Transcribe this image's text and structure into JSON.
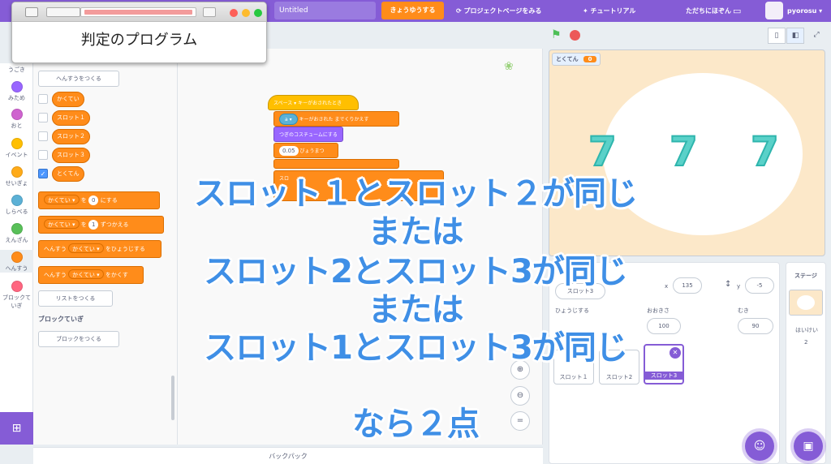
{
  "menubar": {
    "title_value": "Untitled",
    "share_label": "きょうゆうする",
    "project_page_label": "プロジェクトページをみる",
    "tutorial_label": "チュートリアル",
    "save_now_label": "ただちにほぞん",
    "username": "pyorosu",
    "accent_color": "#855cd6"
  },
  "overlay_window": {
    "title": "判定のプログラム"
  },
  "categories": [
    {
      "label": "うごき",
      "color": "#4c97ff"
    },
    {
      "label": "みため",
      "color": "#9966ff"
    },
    {
      "label": "おと",
      "color": "#cf63cf"
    },
    {
      "label": "イベント",
      "color": "#ffbf00"
    },
    {
      "label": "せいぎょ",
      "color": "#ffab19"
    },
    {
      "label": "しらべる",
      "color": "#5cb1d6"
    },
    {
      "label": "えんざん",
      "color": "#59c059"
    },
    {
      "label": "へんすう",
      "color": "#ff8c1a"
    },
    {
      "label": "ブロックていぎ",
      "color": "#ff6680"
    }
  ],
  "palette": {
    "make_variable": "へんすうをつくる",
    "variables": [
      "かくてい",
      "スロット１",
      "スロット２",
      "スロット３",
      "とくてん"
    ],
    "set_block": {
      "var": "かくてい",
      "word": "を",
      "value": "0",
      "suffix": "にする"
    },
    "change_block": {
      "var": "かくてい",
      "word": "を",
      "value": "1",
      "suffix": "ずつかえる"
    },
    "show_block": {
      "prefix": "へんすう",
      "var": "かくてい",
      "suffix": "をひょうじする"
    },
    "hide_block": {
      "prefix": "へんすう",
      "var": "かくてい",
      "suffix": "をかくす"
    },
    "make_list": "リストをつくる",
    "my_blocks_title": "ブロックていぎ",
    "make_block": "ブロックをつくる"
  },
  "code": {
    "hat": "スペース ▾  キーがおされたとき",
    "wait_until": "キーがおされた  までくりかえす",
    "key": "a ▾",
    "next_costume": "つぎのコスチュームにする",
    "wait_value": "0.05",
    "wait_label": "びょうまつ",
    "slot_fragment": "スロ"
  },
  "stage": {
    "monitor_label": "とくてん",
    "monitor_value": "0",
    "digits": [
      "7",
      "7",
      "7"
    ]
  },
  "sprite_info": {
    "sprite_name": "スロット3",
    "x_label": "x",
    "x_value": "135",
    "y_label": "y",
    "y_value": "-5",
    "show_label": "ひょうじする",
    "size_label": "おおきさ",
    "size_value": "100",
    "direction_label": "むき",
    "direction_value": "90"
  },
  "sprites": [
    "スロット１",
    "スロット2",
    "スロット3"
  ],
  "stage_pane": {
    "title": "ステージ",
    "backdrops_label": "はいけい",
    "backdrops_count": "2"
  },
  "backpack_label": "バックパック",
  "captions": [
    "スロット１とスロット２が同じ",
    "または",
    "スロット2とスロット3が同じ",
    "または",
    "スロット1とスロット3が同じ",
    "なら２点"
  ]
}
